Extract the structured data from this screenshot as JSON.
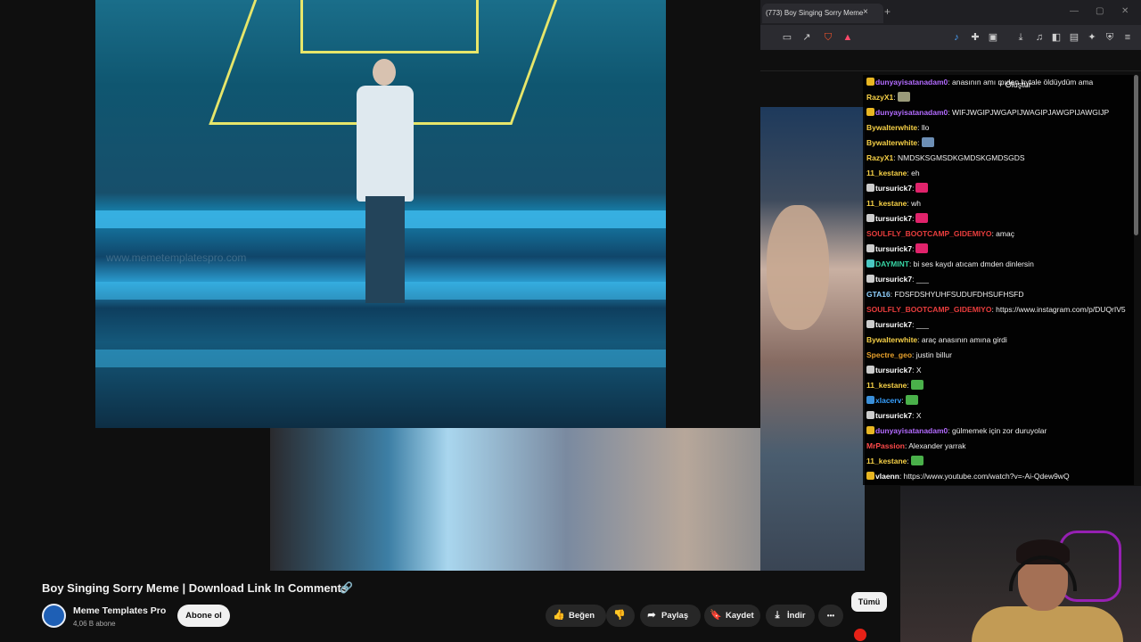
{
  "browser": {
    "tab_title": "(773) Boy Singing Sorry Meme",
    "tab_close": "×",
    "tab_new": "+",
    "window_controls": [
      "—",
      "▢",
      "✕"
    ]
  },
  "video": {
    "watermark": "www.memetemplatespro.com"
  },
  "chat": {
    "create_label": "Oluştur",
    "messages": [
      {
        "user": "dunyayisatanadam0",
        "color": "#b36bff",
        "text": ": anasının amı mıden hytale öldüydüm ama",
        "badge": "#e8b622"
      },
      {
        "user": "RazyX1",
        "color": "#f7d147",
        "text": ":",
        "emote": "#9a9a7a"
      },
      {
        "user": "dunyayisatanadam0",
        "color": "#b36bff",
        "text": ": WIFJWGIPJWGAPIJWAGIPJAWGPIJAWGIJP",
        "badge": "#e8b622"
      },
      {
        "user": "Bywalterwhite",
        "color": "#f7d147",
        "text": ": llo"
      },
      {
        "user": "Bywalterwhite",
        "color": "#f7d147",
        "text": ":",
        "emote": "#6d8fb5"
      },
      {
        "user": "RazyX1",
        "color": "#f7d147",
        "text": ": NMDSKSGMSDKGMDSKGMDSGDS"
      },
      {
        "user": "11_kestane",
        "color": "#f7d147",
        "text": ": eh"
      },
      {
        "user": "tursurick7",
        "color": "#ffffff",
        "text": ":",
        "emote": "#e0236b",
        "badge": "#cccccc"
      },
      {
        "user": "11_kestane",
        "color": "#f7d147",
        "text": ": wh"
      },
      {
        "user": "tursurick7",
        "color": "#ffffff",
        "text": ":",
        "emote": "#e0236b",
        "badge": "#cccccc"
      },
      {
        "user": "SOULFLY_BOOTCAMP_GIDEMIYO",
        "color": "#e93d3d",
        "text": ": amaç"
      },
      {
        "user": "tursurick7",
        "color": "#ffffff",
        "text": ":",
        "emote": "#e0236b",
        "badge": "#cccccc"
      },
      {
        "user": "DAYMINT",
        "color": "#37d6a5",
        "text": ": bi ses kaydı atıcam dmden dinlersin",
        "badge": "#4ac7c2"
      },
      {
        "user": "tursurick7",
        "color": "#ffffff",
        "text": ": ___",
        "badge": "#cccccc"
      },
      {
        "user": "GTA16",
        "color": "#8fd1ff",
        "text": ": FDSFDSHYUHFSUDUFDHSUFHSFD"
      },
      {
        "user": "SOULFLY_BOOTCAMP_GIDEMIYO",
        "color": "#e93d3d",
        "text": ": https://www.instagram.com/p/DUQrIV5"
      },
      {
        "user": "tursurick7",
        "color": "#ffffff",
        "text": ": ___",
        "badge": "#cccccc"
      },
      {
        "user": "Bywalterwhite",
        "color": "#f7d147",
        "text": ": araç anasının amına girdi"
      },
      {
        "user": "Spectre_geo",
        "color": "#e8a12b",
        "text": ": justin billur"
      },
      {
        "user": "tursurick7",
        "color": "#ffffff",
        "text": ": X",
        "badge": "#cccccc"
      },
      {
        "user": "11_kestane",
        "color": "#f7d147",
        "text": ":",
        "emote": "#4ab04a"
      },
      {
        "user": "xlacerv",
        "color": "#37a0ff",
        "text": ":",
        "emote": "#4ab04a",
        "badge": "#3a8fd9"
      },
      {
        "user": "tursurick7",
        "color": "#ffffff",
        "text": ": X",
        "badge": "#cccccc"
      },
      {
        "user": "dunyayisatanadam0",
        "color": "#b36bff",
        "text": ": gülmemek için zor duruyolar",
        "badge": "#e8b622"
      },
      {
        "user": "MrPassion",
        "color": "#ff4a4a",
        "text": ": Alexander yarrak"
      },
      {
        "user": "11_kestane",
        "color": "#f7d147",
        "text": ":",
        "emote": "#4ab04a"
      },
      {
        "user": "vlaenn",
        "color": "#ffffff",
        "text": ": https://www.youtube.com/watch?v=-Ai-Qdew9wQ",
        "badge": "#e8b622"
      }
    ]
  },
  "youtube": {
    "title": "Boy Singing Sorry Meme | Download Link In Comments",
    "link_icon": "🔗",
    "channel_name": "Meme Templates Pro",
    "subscribers": "4,06 B abone",
    "subscribe_label": "Abone ol",
    "like_label": "Beğen",
    "share_label": "Paylaş",
    "save_label": "Kaydet",
    "download_label": "İndir",
    "more_label": "•••",
    "filter_all": "Tümü"
  }
}
